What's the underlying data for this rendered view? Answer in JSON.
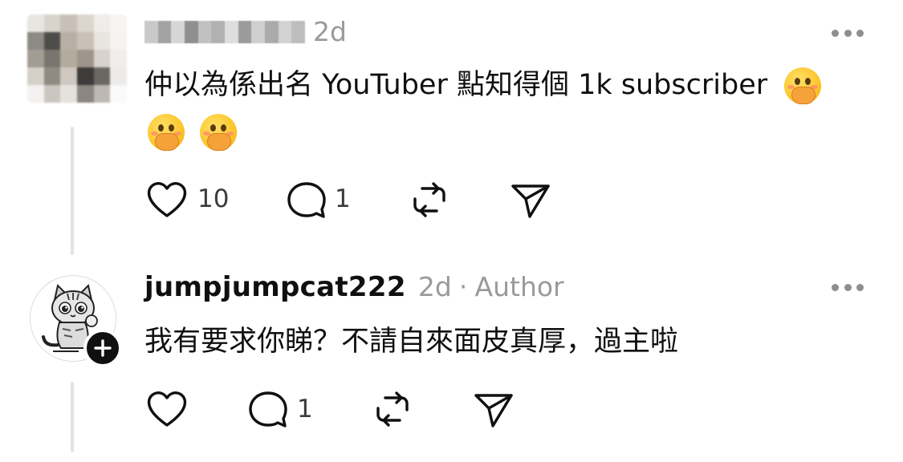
{
  "comments": [
    {
      "username": "",
      "time": "2d",
      "text_line1": "仲以為係出名 YouTuber 點知得個 1k subscriber",
      "emoji_count": 3,
      "emoji_icon": "hand-over-mouth-emoji",
      "likes": "10",
      "replies": "1"
    },
    {
      "username": "jumpjumpcat222",
      "time": "2d",
      "separator": "·",
      "role": "Author",
      "text": "我有要求你睇？不請自來面皮真厚，過主啦",
      "likes": "",
      "replies": "1"
    }
  ],
  "icons": {
    "like": "heart-icon",
    "reply": "comment-bubble-icon",
    "repost": "repost-icon",
    "share": "send-icon",
    "more": "more-horizontal-icon",
    "follow": "plus-icon"
  },
  "colors": {
    "text": "#101010",
    "muted": "#9a9a9a",
    "badge": "#101010"
  }
}
